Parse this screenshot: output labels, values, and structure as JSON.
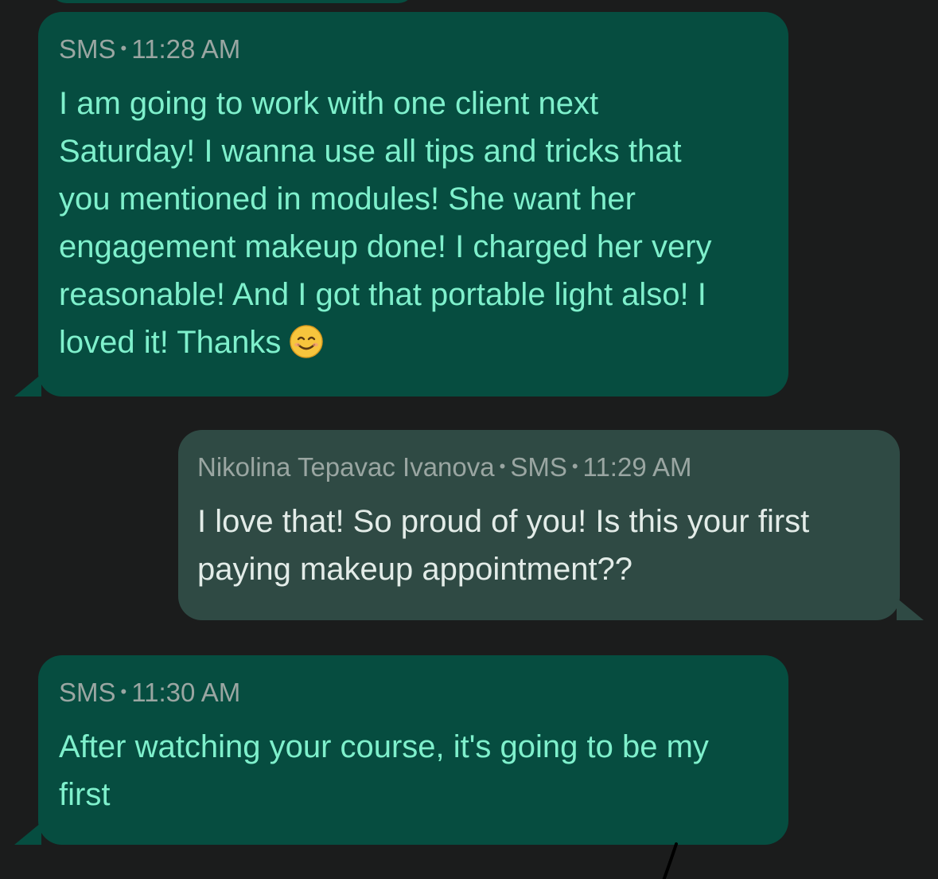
{
  "messages": [
    {
      "direction": "incoming",
      "channel": "SMS",
      "time": "11:28 AM",
      "text": "I am going to work with one client next\nSaturday! I wanna use all tips and tricks that\nyou mentioned in modules! She want her\nengagement makeup done! I charged her very\nreasonable! And I got that portable light also! I\nloved it! Thanks",
      "emoji": "smiling-face-icon"
    },
    {
      "direction": "outgoing",
      "sender": "Nikolina Tepavac Ivanova",
      "channel": "SMS",
      "time": "11:29 AM",
      "text": "I love that! So proud of you! Is this your first\npaying makeup appointment??"
    },
    {
      "direction": "incoming",
      "channel": "SMS",
      "time": "11:30 AM",
      "text": "After watching your course, it's going to be my\nfirst"
    }
  ],
  "colors": {
    "background": "#1b1c1c",
    "incoming_bubble": "#064d40",
    "incoming_text": "#7ff0cc",
    "outgoing_bubble": "#2f4a44",
    "outgoing_text": "#e3ece8",
    "meta_text": "#9aa6a2"
  }
}
